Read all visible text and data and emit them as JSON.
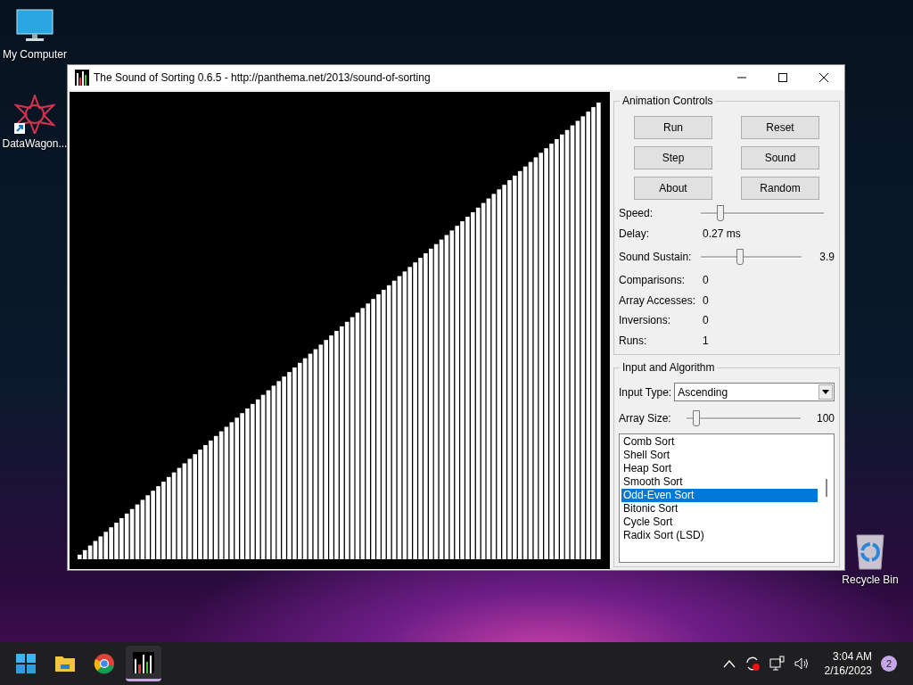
{
  "desktop_icons": [
    {
      "label": "My Computer",
      "kind": "computer"
    },
    {
      "label": "DataWagon...",
      "kind": "shortcut"
    },
    {
      "label": "Recycle Bin",
      "kind": "recycle"
    }
  ],
  "window": {
    "title": "The Sound of Sorting 0.6.5 - http://panthema.net/2013/sound-of-sorting",
    "animation_controls": {
      "title": "Animation Controls",
      "buttons": [
        {
          "label": "Run"
        },
        {
          "label": "Reset"
        },
        {
          "label": "Step"
        },
        {
          "label": "Sound"
        },
        {
          "label": "About"
        },
        {
          "label": "Random"
        }
      ],
      "speed": {
        "label": "Speed:",
        "level": 0.15
      },
      "delay": {
        "label": "Delay:",
        "value": "0.27 ms"
      },
      "sound_sustain": {
        "label": "Sound Sustain:",
        "level": 0.38,
        "reading": "3.9"
      },
      "stats": [
        {
          "label": "Comparisons:",
          "value": "0"
        },
        {
          "label": "Array Accesses:",
          "value": "0"
        },
        {
          "label": "Inversions:",
          "value": "0"
        },
        {
          "label": "Runs:",
          "value": "1"
        }
      ]
    },
    "input_and_algorithm": {
      "title": "Input and Algorithm",
      "input_type": {
        "label": "Input Type:",
        "value": "Ascending"
      },
      "array_size": {
        "label": "Array Size:",
        "level": 0.08,
        "reading": "100"
      },
      "algorithms": [
        {
          "name": "Comb Sort",
          "selected": false
        },
        {
          "name": "Shell Sort",
          "selected": false
        },
        {
          "name": "Heap Sort",
          "selected": false
        },
        {
          "name": "Smooth Sort",
          "selected": false
        },
        {
          "name": "Odd-Even Sort",
          "selected": true
        },
        {
          "name": "Bitonic Sort",
          "selected": false
        },
        {
          "name": "Cycle Sort",
          "selected": false
        },
        {
          "name": "Radix Sort (LSD)",
          "selected": false
        }
      ]
    }
  },
  "taskbar": {
    "apps": [
      {
        "kind": "start",
        "active": false
      },
      {
        "kind": "files",
        "active": false
      },
      {
        "kind": "browser",
        "active": false
      },
      {
        "kind": "sorting",
        "active": true
      }
    ],
    "time": "3:04 AM",
    "date": "2/16/2023",
    "notifications": "2"
  }
}
